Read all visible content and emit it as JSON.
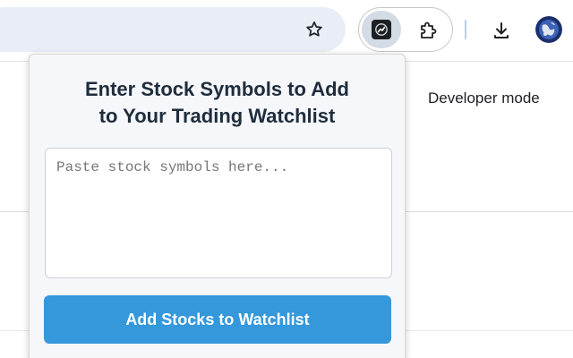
{
  "toolbar": {
    "icons": {
      "bookmark": "star-outline",
      "extension_active": "trading-extension-logo",
      "extensions_menu": "puzzle-piece",
      "downloads": "download-arrow",
      "profile": "globe-avatar"
    }
  },
  "page": {
    "developer_mode_label": "Developer mode"
  },
  "popup": {
    "title": "Enter Stock Symbols to Add\nto Your Trading Watchlist",
    "input": {
      "value": "",
      "placeholder": "Paste stock symbols here..."
    },
    "add_button_label": "Add Stocks to Watchlist"
  },
  "colors": {
    "button": "#3498db",
    "title": "#1f2d3d",
    "popup_bg": "#f5f7fa",
    "omnibox_bg": "#e9eef6"
  }
}
